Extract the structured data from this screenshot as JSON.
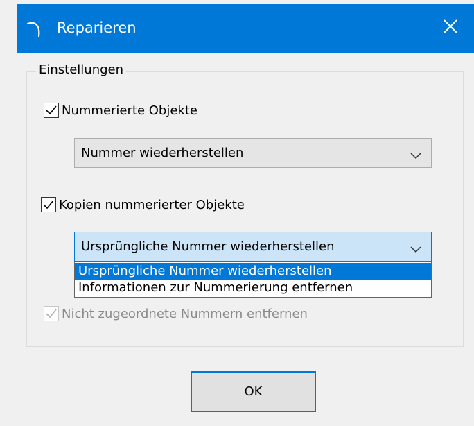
{
  "window": {
    "title": "Reparieren",
    "accent_color": "#0078d7",
    "icons": {
      "app": "app-swoosh-icon",
      "close": "close-icon"
    }
  },
  "settings": {
    "group_label": "Einstellungen",
    "numbered_objects": {
      "label": "Nummerierte Objekte",
      "checked": true,
      "combo_value": "Nummer wiederherstellen"
    },
    "copies_numbered_objects": {
      "label": "Kopien nummerierter Objekte",
      "checked": true,
      "combo_value": "Ursprüngliche Nummer wiederherstellen",
      "dropdown_open": true,
      "options": [
        "Ursprüngliche Nummer wiederherstellen",
        "Informationen zur Nummerierung entfernen"
      ],
      "selected_index": 0
    },
    "remove_unassigned_numbers": {
      "label": "Nicht zugeordnete Nummern entfernen",
      "checked": true,
      "disabled": true
    }
  },
  "footer": {
    "ok_label": "OK"
  }
}
